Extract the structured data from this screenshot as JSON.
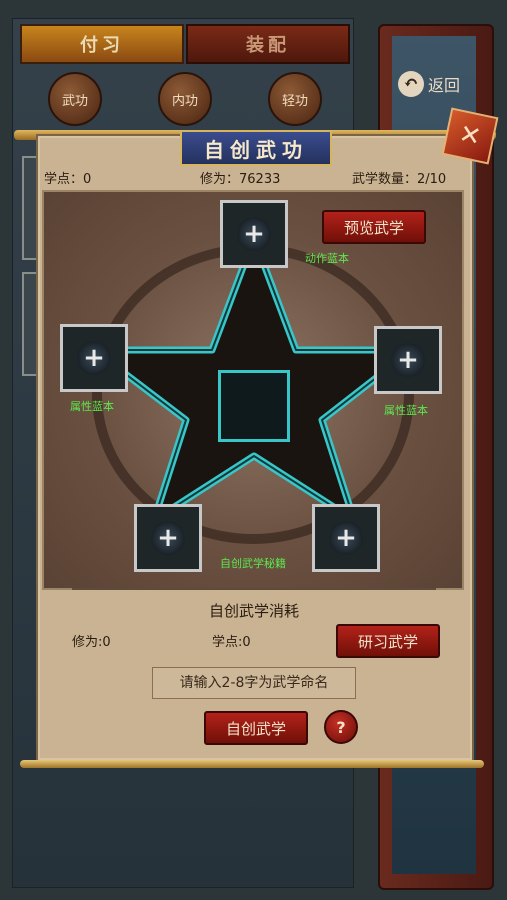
{
  "background": {
    "tabs": [
      "付习",
      "装配"
    ],
    "round_buttons": [
      "武功",
      "内功",
      "轻功"
    ],
    "back_label": "返回",
    "close_icon": "close-icon"
  },
  "dialog": {
    "title": "自创武功",
    "stats": {
      "xuedian": "学点：0",
      "xiuwei": "修为：76233",
      "count": "武学数量：2/10"
    },
    "preview_button": "预览武学",
    "slots": {
      "top_label": "动作蓝本",
      "left_label": "属性蓝本",
      "right_label": "属性蓝本",
      "bottom_label": "自创武学秘籍"
    },
    "cost": {
      "title": "自创武学消耗",
      "xiuwei": "修为:0",
      "xuedian": "学点:0",
      "study_button": "研习武学"
    },
    "name_input": {
      "placeholder": "请输入2-8字为武学命名",
      "value": ""
    },
    "create_button": "自创武学",
    "help_button": "?"
  },
  "colors": {
    "accent_red": "#b2221a",
    "slot_label_green": "#5ee84e",
    "star_cyan": "#3ac6c8",
    "parchment": "#c9b393"
  }
}
